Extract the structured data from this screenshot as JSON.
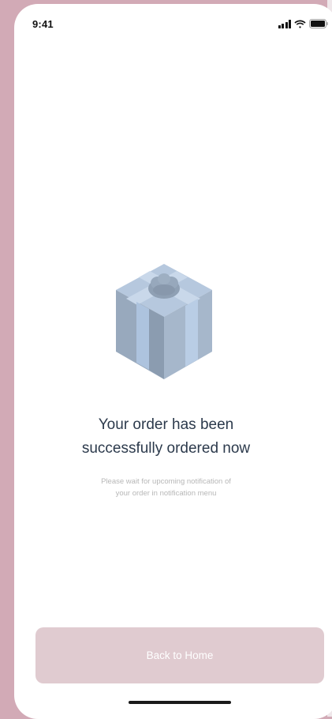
{
  "status_bar": {
    "time": "9:41",
    "icons": [
      "signal-icon",
      "wifi-icon",
      "battery-icon"
    ]
  },
  "illustration": {
    "icon": "gift-box-icon",
    "colors": {
      "light": "#b6c8de",
      "mid": "#98a9bd",
      "dark": "#7f90a4",
      "ribbon": "#a9c0dc"
    }
  },
  "confirmation": {
    "title_line1": "Your order has been",
    "title_line2": "successfully ordered now",
    "message_line1": "Please wait for upcoming notification of",
    "message_line2": "your order in notification menu"
  },
  "actions": {
    "back_home_label": "Back to Home"
  },
  "colors": {
    "background": "#d2aab6",
    "button": "#e0cbd0",
    "title_text": "#2c3a4c",
    "secondary_text": "#b7b7b7"
  }
}
